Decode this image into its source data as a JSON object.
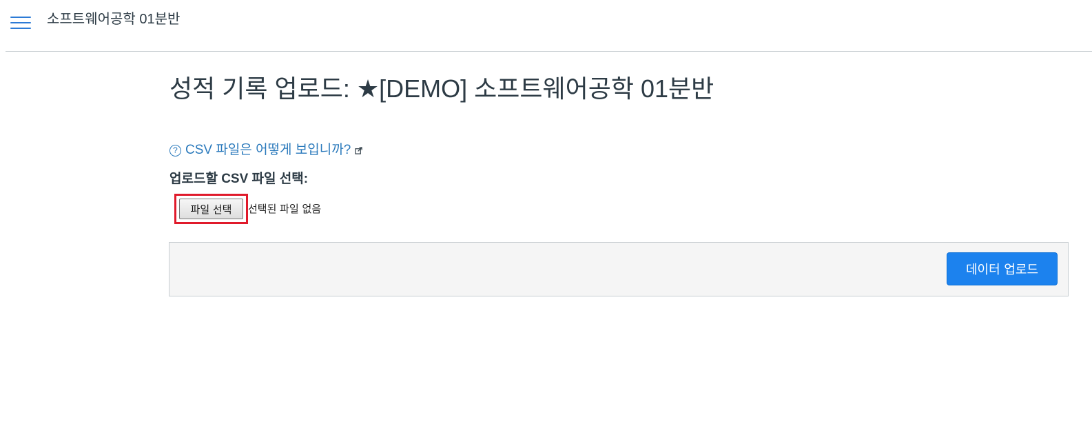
{
  "header": {
    "menu_icon": "hamburger-menu-icon",
    "course_name": "소프트웨어공학 01분반"
  },
  "main": {
    "title": "성적 기록 업로드: ★[DEMO] 소프트웨어공학 01분반",
    "help_link": {
      "icon": "question-circle-icon",
      "text": "CSV 파일은 어떻게 보입니까?",
      "external_icon": "external-link-icon"
    },
    "file_label": "업로드할 CSV 파일 선택:",
    "file_button_label": "파일 선택",
    "file_status": "선택된 파일 없음",
    "upload_button_label": "데이터 업로드"
  },
  "colors": {
    "link": "#2b7abc",
    "primary_button": "#1c82ee",
    "highlight": "#e01a2b",
    "menu_icon": "#2d7bd6"
  }
}
